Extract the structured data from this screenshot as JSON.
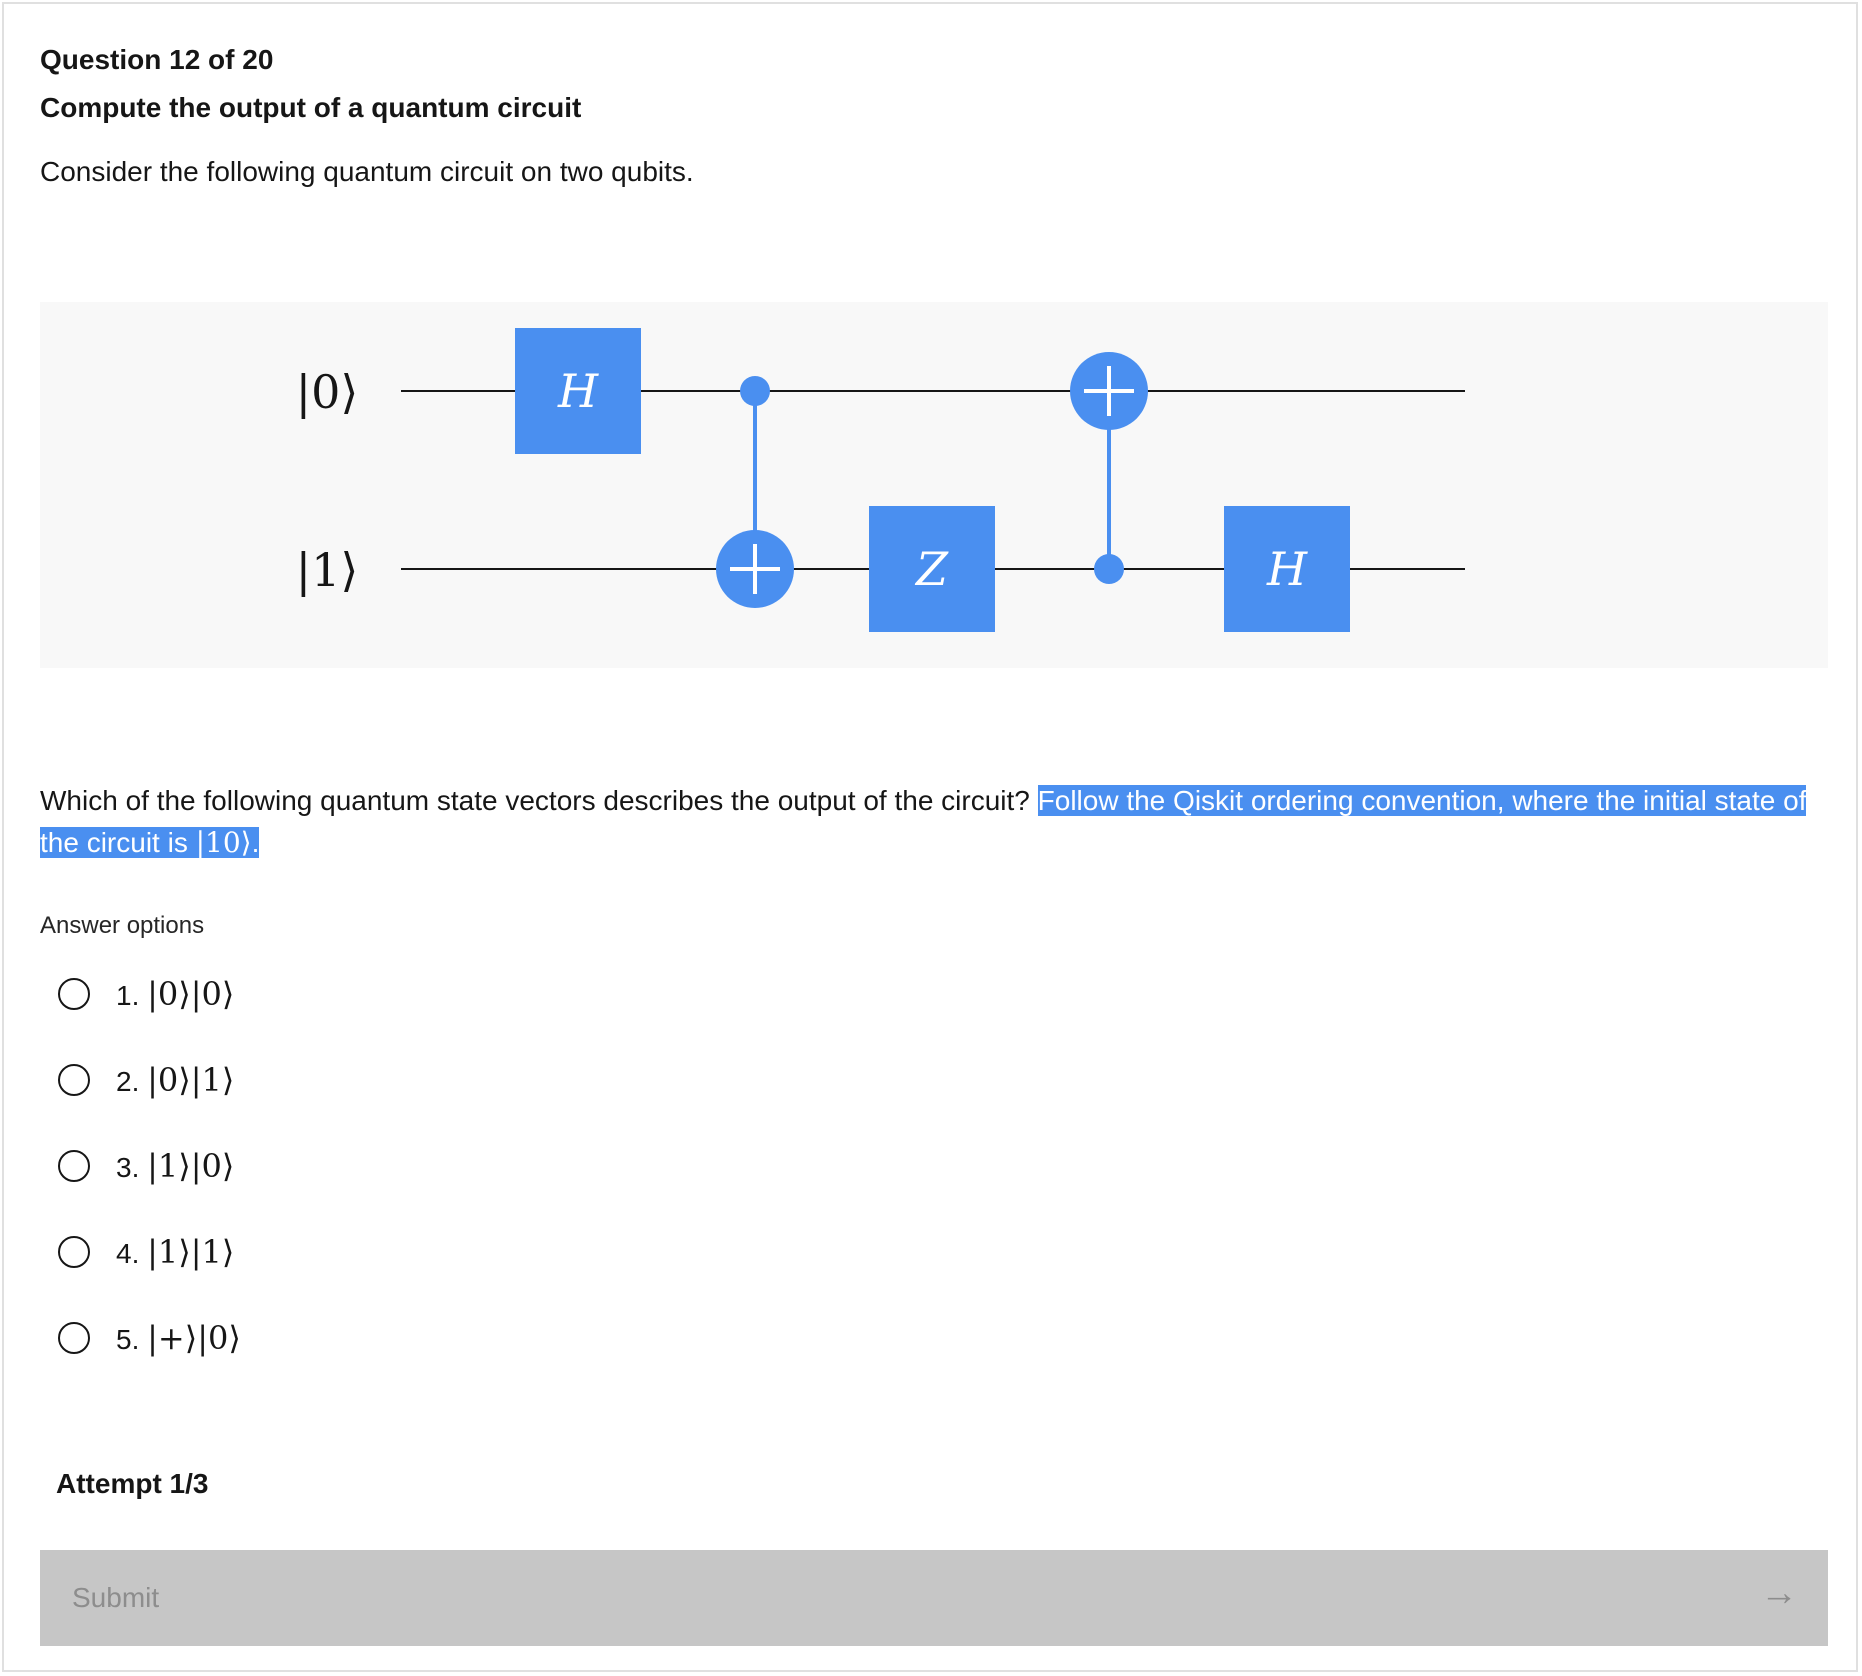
{
  "question": {
    "number": "Question 12 of 20",
    "title": "Compute the output of a quantum circuit",
    "intro": "Consider the following quantum circuit on two qubits."
  },
  "circuit": {
    "inputs": [
      "|0⟩",
      "|1⟩"
    ],
    "gates": [
      {
        "type": "H",
        "label": "H",
        "qubit": 0
      },
      {
        "type": "CNOT",
        "control": 0,
        "target": 1
      },
      {
        "type": "Z",
        "label": "Z",
        "qubit": 1
      },
      {
        "type": "CNOT",
        "control": 1,
        "target": 0
      },
      {
        "type": "H",
        "label": "H",
        "qubit": 1
      }
    ],
    "color": "#4a8ff0"
  },
  "prompt": {
    "text": "Which of the following quantum state vectors describes the output of the circuit? ",
    "highlight_text": "Follow the Qiskit ordering convention, where the initial state of the circuit is ",
    "highlight_ket": "|10⟩",
    "highlight_end": "."
  },
  "answers": {
    "label": "Answer options",
    "options": [
      {
        "num": "1.",
        "ket": "|0⟩|0⟩"
      },
      {
        "num": "2.",
        "ket": "|0⟩|1⟩"
      },
      {
        "num": "3.",
        "ket": "|1⟩|0⟩"
      },
      {
        "num": "4.",
        "ket": "|1⟩|1⟩"
      },
      {
        "num": "5.",
        "ket": "|+⟩|0⟩"
      }
    ]
  },
  "attempt": "Attempt 1/3",
  "submit": {
    "label": "Submit",
    "icon": "arrow-right-icon",
    "arrow": "→"
  },
  "colors": {
    "accent": "#4a8ff0",
    "submit_bg": "#c6c6c6",
    "submit_text": "#8d8d8d"
  }
}
